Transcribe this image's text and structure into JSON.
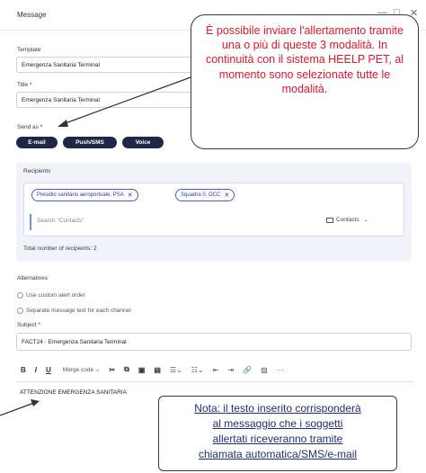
{
  "window": {
    "title": "Message",
    "minimize_glyph": "—",
    "maximize_glyph": "□",
    "close_glyph": "✕"
  },
  "form": {
    "template_label": "Template",
    "template_value": "Emergenza Sanitaria Terminal",
    "title_label": "Title *",
    "title_value": "Emergenza Sanitaria Terminal",
    "send_as_label": "Send as *",
    "send_as_options": [
      "E-mail",
      "Push/SMS",
      "Voice"
    ],
    "recipients_label": "Recipients",
    "recipient_chips": [
      "Presidio sanitario aeroportuale, PSA",
      "Squadra 0, OCC"
    ],
    "search_placeholder": "Search \"Contacts\"",
    "contacts_dropdown": "Contacts",
    "total_recipients": "Total number of recipients: 2",
    "alternatives_label": "Alternatives",
    "alt_option_1": "Use custom alert order",
    "alt_option_2": "Separate message text for each channel",
    "subject_label": "Subject *",
    "subject_value": "FACT24 · Emergenza Sanitaria Terminal",
    "toolbar": {
      "bold": "B",
      "italic": "I",
      "underline": "U",
      "merge_code": "Merge code",
      "more": "···"
    },
    "body_text": "ATTENZIONE EMERGENZA SANITARIA"
  },
  "annotations": {
    "red_callout": "È possibile inviare l'allertamento tramite una o più di queste 3 modalità. In continuità con il sistema HEELP PET, al momento sono selezionate tutte le modalità.",
    "blue_callout_lines": [
      "Nota: il testo inserito corrisponderà",
      "al messaggio che i soggetti",
      "allertati riceveranno tramite",
      "chiamata automatica/SMS/e-mail"
    ]
  },
  "colors": {
    "pill_bg": "#1f2746",
    "chip_border": "#4a5bd0",
    "red_text": "#e4162b",
    "blue_text": "#1f2e7a"
  }
}
